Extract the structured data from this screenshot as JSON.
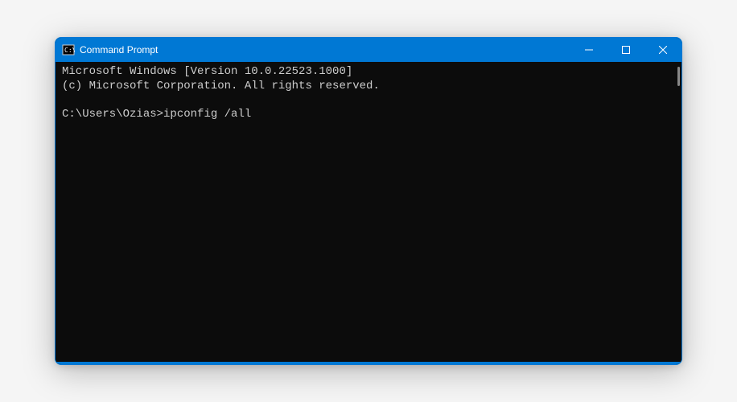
{
  "titlebar": {
    "title": "Command Prompt"
  },
  "terminal": {
    "line1": "Microsoft Windows [Version 10.0.22523.1000]",
    "line2": "(c) Microsoft Corporation. All rights reserved.",
    "prompt": "C:\\Users\\Ozias>",
    "command": "ipconfig /all"
  }
}
